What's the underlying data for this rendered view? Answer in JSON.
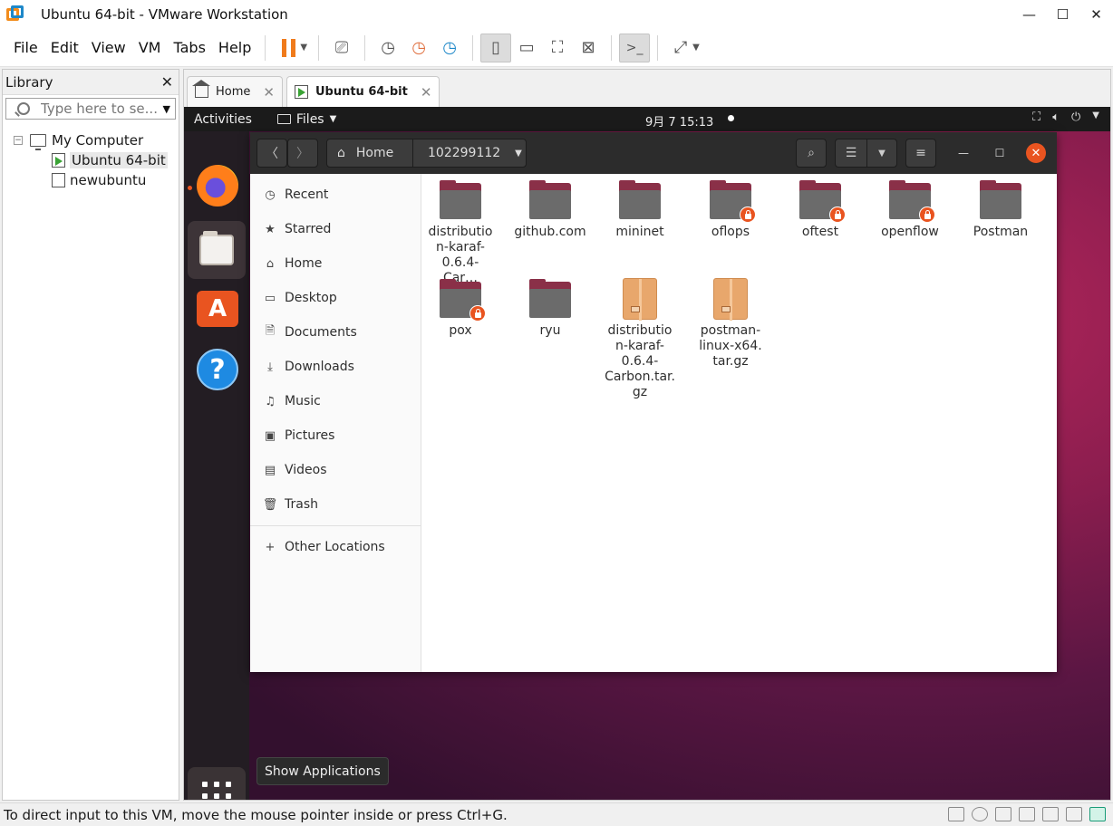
{
  "window": {
    "title": "Ubuntu 64-bit - VMware Workstation"
  },
  "menu": [
    "File",
    "Edit",
    "View",
    "VM",
    "Tabs",
    "Help"
  ],
  "library": {
    "title": "Library",
    "search_placeholder": "Type here to se...",
    "root": "My Computer",
    "vms": [
      "Ubuntu 64-bit",
      "newubuntu"
    ]
  },
  "tabs": [
    {
      "label": "Home",
      "active": false
    },
    {
      "label": "Ubuntu 64-bit",
      "active": true
    }
  ],
  "ubuntu": {
    "activities": "Activities",
    "app_menu": "Files",
    "clock": "9月 7  15:13",
    "tooltip": "Show Applications",
    "files": {
      "location": {
        "home": "Home",
        "current": "102299112"
      },
      "sidebar": [
        {
          "label": "Recent",
          "icon": "clock-icon"
        },
        {
          "label": "Starred",
          "icon": "star-icon"
        },
        {
          "label": "Home",
          "icon": "home-icon"
        },
        {
          "label": "Desktop",
          "icon": "desktop-icon"
        },
        {
          "label": "Documents",
          "icon": "document-icon"
        },
        {
          "label": "Downloads",
          "icon": "download-icon"
        },
        {
          "label": "Music",
          "icon": "music-icon"
        },
        {
          "label": "Pictures",
          "icon": "picture-icon"
        },
        {
          "label": "Videos",
          "icon": "video-icon"
        },
        {
          "label": "Trash",
          "icon": "trash-icon"
        }
      ],
      "other_locations": "Other Locations",
      "items": [
        {
          "name": "distributio n-karaf- 0.6.4-Car…",
          "kind": "folder",
          "locked": false
        },
        {
          "name": "github.com",
          "kind": "folder",
          "locked": false
        },
        {
          "name": "mininet",
          "kind": "folder",
          "locked": false
        },
        {
          "name": "oflops",
          "kind": "folder",
          "locked": true
        },
        {
          "name": "oftest",
          "kind": "folder",
          "locked": true
        },
        {
          "name": "openflow",
          "kind": "folder",
          "locked": true
        },
        {
          "name": "Postman",
          "kind": "folder",
          "locked": false
        },
        {
          "name": "pox",
          "kind": "folder",
          "locked": true
        },
        {
          "name": "ryu",
          "kind": "folder",
          "locked": false
        },
        {
          "name": "distributio n-karaf- 0.6.4- Carbon.tar. gz",
          "kind": "archive",
          "locked": false
        },
        {
          "name": "postman- linux-x64. tar.gz",
          "kind": "archive",
          "locked": false
        }
      ]
    }
  },
  "status": {
    "message": "To direct input to this VM, move the mouse pointer inside or press Ctrl+G."
  },
  "colors": {
    "ubuntu_orange": "#e95420",
    "folder_back": "#8a3048",
    "vmware_orange": "#f07b1c"
  }
}
